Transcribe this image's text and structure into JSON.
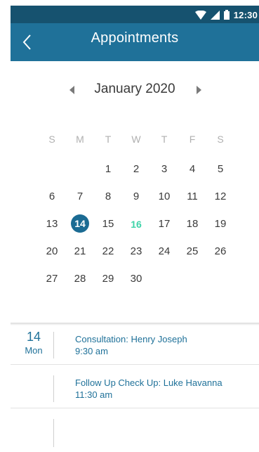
{
  "status_bar": {
    "time": "12:30",
    "icons": [
      "wifi-icon",
      "signal-icon",
      "battery-icon"
    ]
  },
  "app_bar": {
    "title": "Appointments",
    "back_icon": "chevron-left-icon"
  },
  "calendar": {
    "month_label": "January 2020",
    "weekdays": [
      "S",
      "M",
      "T",
      "W",
      "T",
      "F",
      "S"
    ],
    "weeks": [
      [
        "",
        "",
        "1",
        "2",
        "3",
        "4",
        "5"
      ],
      [
        "6",
        "7",
        "8",
        "9",
        "10",
        "11",
        "12"
      ],
      [
        "13",
        "14",
        "15",
        "16",
        "17",
        "18",
        "19"
      ],
      [
        "20",
        "21",
        "22",
        "23",
        "24",
        "25",
        "26"
      ],
      [
        "27",
        "28",
        "29",
        "30",
        "",
        "",
        ""
      ]
    ],
    "selected_day": "14",
    "highlighted_day": "16",
    "colors": {
      "selected": "#1b6b93",
      "highlight": "#3ed3a8",
      "header": "#1f7199"
    }
  },
  "agenda": {
    "date_number": "14",
    "date_weekday": "Mon",
    "appointments": [
      {
        "title": "Consultation: Henry Joseph",
        "time": "9:30 am"
      },
      {
        "title": "Follow Up Check Up: Luke Havanna",
        "time": "11:30 am"
      }
    ]
  }
}
